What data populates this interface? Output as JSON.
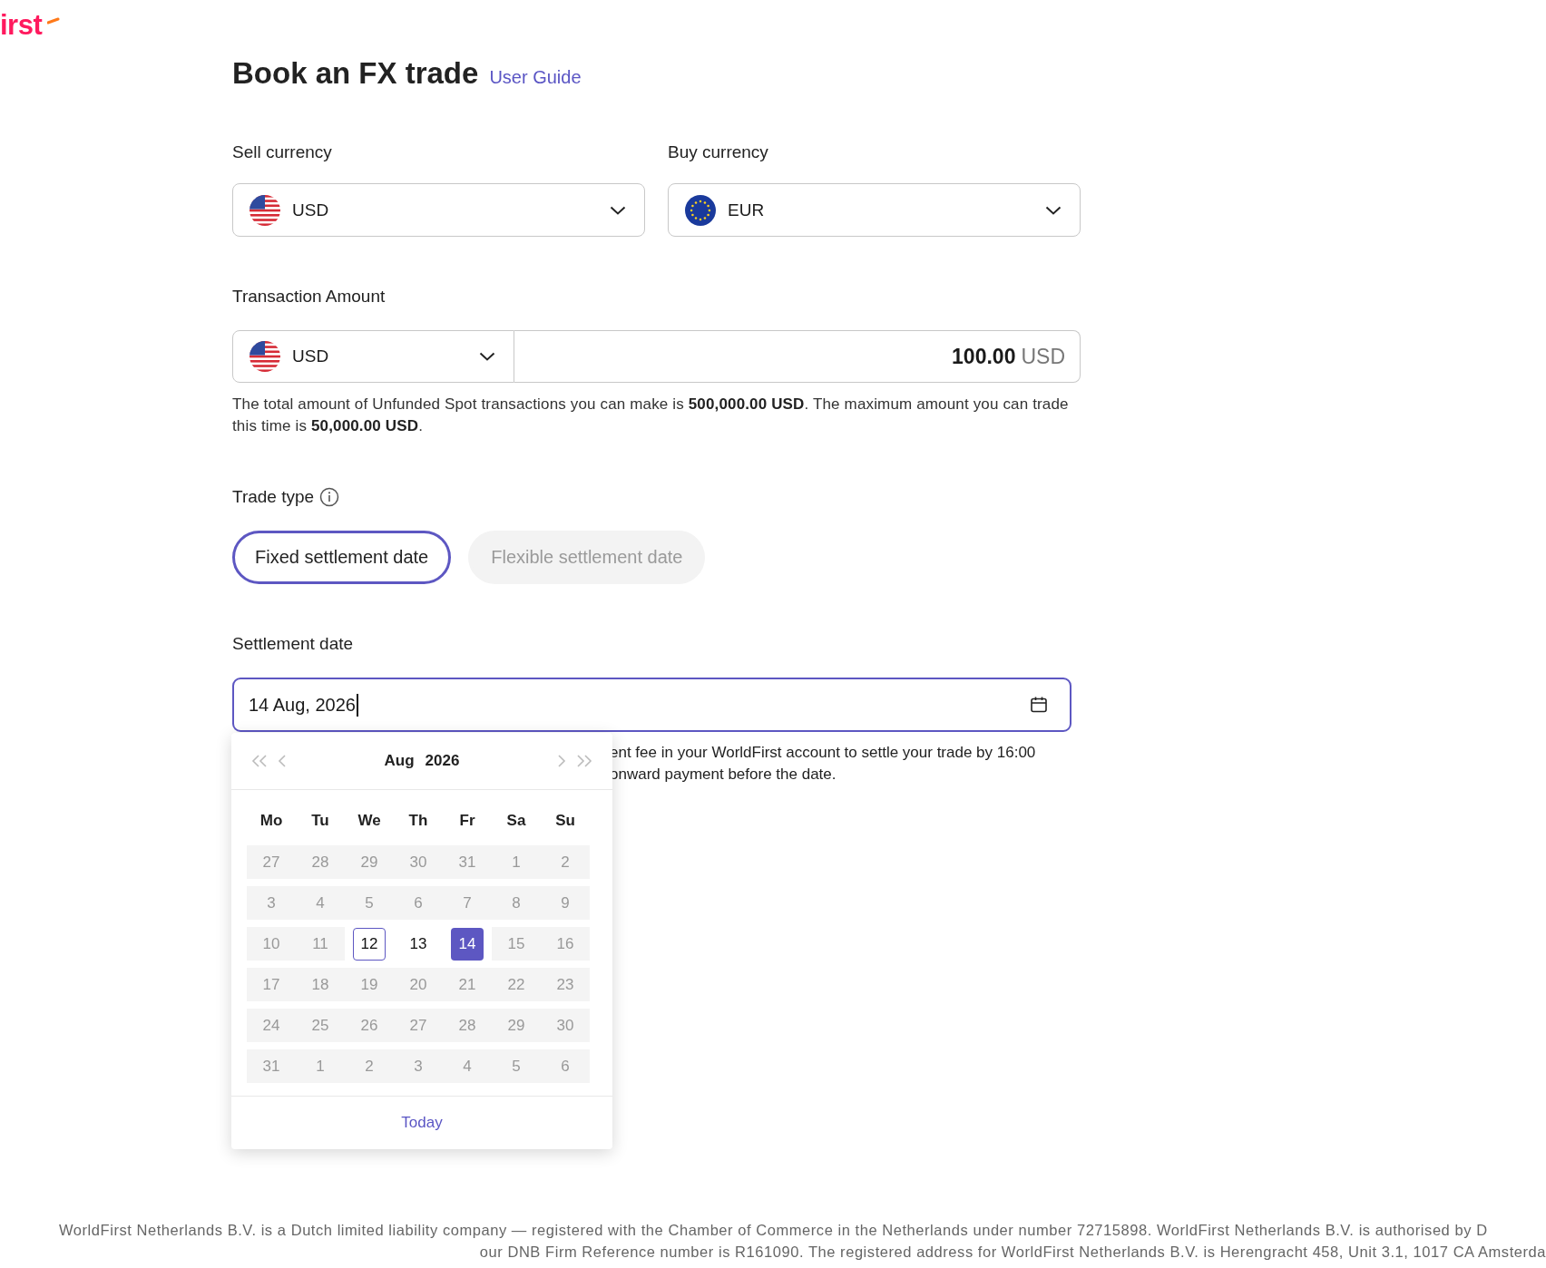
{
  "logo": {
    "text": "irst"
  },
  "title": "Book an FX trade",
  "user_guide": "User Guide",
  "sell": {
    "label": "Sell currency",
    "currency": "USD",
    "kind": "us"
  },
  "buy": {
    "label": "Buy currency",
    "currency": "EUR",
    "kind": "eu"
  },
  "amount": {
    "label": "Transaction Amount",
    "currency": "USD",
    "kind": "us",
    "value": "100.00",
    "unit": "USD"
  },
  "limits_note": "The total amount of Unfunded Spot transactions you can make is **500,000.00 USD**. The maximum amount you can trade this time is **50,000.00 USD**.",
  "trade_type": {
    "label": "Trade type",
    "options": [
      {
        "label": "Fixed settlement date",
        "selected": true,
        "disabled": false
      },
      {
        "label": "Flexible settlement date",
        "selected": false,
        "disabled": true
      }
    ]
  },
  "settlement": {
    "label": "Settlement date",
    "value": "14 Aug, 2026",
    "helper_lines": [
      "ent fee in your WorldFirst account to settle your trade by 16:00",
      "onward payment before the date."
    ]
  },
  "calendar": {
    "month": "Aug",
    "year": "2026",
    "weekdays": [
      "Mo",
      "Tu",
      "We",
      "Th",
      "Fr",
      "Sa",
      "Su"
    ],
    "weeks": [
      [
        {
          "day": "27",
          "disabled": true,
          "today": false,
          "selected": false
        },
        {
          "day": "28",
          "disabled": true,
          "today": false,
          "selected": false
        },
        {
          "day": "29",
          "disabled": true,
          "today": false,
          "selected": false
        },
        {
          "day": "30",
          "disabled": true,
          "today": false,
          "selected": false
        },
        {
          "day": "31",
          "disabled": true,
          "today": false,
          "selected": false
        },
        {
          "day": "1",
          "disabled": true,
          "today": false,
          "selected": false
        },
        {
          "day": "2",
          "disabled": true,
          "today": false,
          "selected": false
        }
      ],
      [
        {
          "day": "3",
          "disabled": true,
          "today": false,
          "selected": false
        },
        {
          "day": "4",
          "disabled": true,
          "today": false,
          "selected": false
        },
        {
          "day": "5",
          "disabled": true,
          "today": false,
          "selected": false
        },
        {
          "day": "6",
          "disabled": true,
          "today": false,
          "selected": false
        },
        {
          "day": "7",
          "disabled": true,
          "today": false,
          "selected": false
        },
        {
          "day": "8",
          "disabled": true,
          "today": false,
          "selected": false
        },
        {
          "day": "9",
          "disabled": true,
          "today": false,
          "selected": false
        }
      ],
      [
        {
          "day": "10",
          "disabled": true,
          "today": false,
          "selected": false
        },
        {
          "day": "11",
          "disabled": true,
          "today": false,
          "selected": false
        },
        {
          "day": "12",
          "disabled": false,
          "today": true,
          "selected": false
        },
        {
          "day": "13",
          "disabled": false,
          "today": false,
          "selected": false
        },
        {
          "day": "14",
          "disabled": false,
          "today": false,
          "selected": true
        },
        {
          "day": "15",
          "disabled": true,
          "today": false,
          "selected": false
        },
        {
          "day": "16",
          "disabled": true,
          "today": false,
          "selected": false
        }
      ],
      [
        {
          "day": "17",
          "disabled": true,
          "today": false,
          "selected": false
        },
        {
          "day": "18",
          "disabled": true,
          "today": false,
          "selected": false
        },
        {
          "day": "19",
          "disabled": true,
          "today": false,
          "selected": false
        },
        {
          "day": "20",
          "disabled": true,
          "today": false,
          "selected": false
        },
        {
          "day": "21",
          "disabled": true,
          "today": false,
          "selected": false
        },
        {
          "day": "22",
          "disabled": true,
          "today": false,
          "selected": false
        },
        {
          "day": "23",
          "disabled": true,
          "today": false,
          "selected": false
        }
      ],
      [
        {
          "day": "24",
          "disabled": true,
          "today": false,
          "selected": false
        },
        {
          "day": "25",
          "disabled": true,
          "today": false,
          "selected": false
        },
        {
          "day": "26",
          "disabled": true,
          "today": false,
          "selected": false
        },
        {
          "day": "27",
          "disabled": true,
          "today": false,
          "selected": false
        },
        {
          "day": "28",
          "disabled": true,
          "today": false,
          "selected": false
        },
        {
          "day": "29",
          "disabled": true,
          "today": false,
          "selected": false
        },
        {
          "day": "30",
          "disabled": true,
          "today": false,
          "selected": false
        }
      ],
      [
        {
          "day": "31",
          "disabled": true,
          "today": false,
          "selected": false
        },
        {
          "day": "1",
          "disabled": true,
          "today": false,
          "selected": false
        },
        {
          "day": "2",
          "disabled": true,
          "today": false,
          "selected": false
        },
        {
          "day": "3",
          "disabled": true,
          "today": false,
          "selected": false
        },
        {
          "day": "4",
          "disabled": true,
          "today": false,
          "selected": false
        },
        {
          "day": "5",
          "disabled": true,
          "today": false,
          "selected": false
        },
        {
          "day": "6",
          "disabled": true,
          "today": false,
          "selected": false
        }
      ]
    ],
    "today_button": "Today"
  },
  "footer_lines": [
    "WorldFirst Netherlands B.V. is a Dutch limited liability company — registered with the Chamber of Commerce in the Netherlands under number 72715898. WorldFirst Netherlands B.V. is authorised by D",
    "our DNB Firm Reference number is R161090. The registered address for WorldFirst Netherlands B.V. is Herengracht 458, Unit 3.1, 1017 CA Amsterda"
  ]
}
